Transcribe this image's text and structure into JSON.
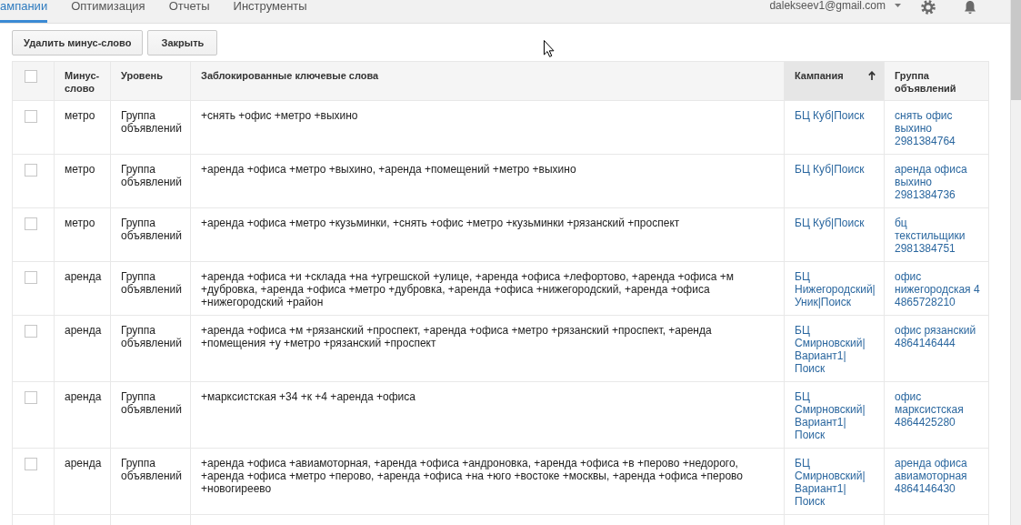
{
  "nav": {
    "tabs": [
      {
        "label": "ампании",
        "selected": true
      },
      {
        "label": "Оптимизация",
        "selected": false
      },
      {
        "label": "Отчеты",
        "selected": false
      },
      {
        "label": "Инструменты",
        "selected": false
      }
    ],
    "account": "dalekseev1@gmail.com"
  },
  "toolbar": {
    "buttons": [
      "Удалить минус-слово",
      "Закрыть"
    ]
  },
  "table": {
    "select_all_checked": false,
    "columns": [
      {
        "label": "Минус-слово",
        "sorted": false
      },
      {
        "label": "Уровень",
        "sorted": false
      },
      {
        "label": "Заблокированные ключевые слова",
        "sorted": false
      },
      {
        "label": "Кампания",
        "sorted": true
      },
      {
        "label": "Группа объявлений",
        "sorted": false
      }
    ],
    "rows": [
      {
        "checked": false,
        "negative_keyword": "метро",
        "scope": "Группа объявлений",
        "blocked_keywords": "+снять +офис +метро +выхино",
        "campaign": "БЦ Куб|Поиск",
        "ad_group": "снять офис выхино 2981384764"
      },
      {
        "checked": false,
        "negative_keyword": "метро",
        "scope": "Группа объявлений",
        "blocked_keywords": "+аренда +офиса +метро +выхино, +аренда +помещений +метро +выхино",
        "campaign": "БЦ Куб|Поиск",
        "ad_group": "аренда офиса выхино 2981384736"
      },
      {
        "checked": false,
        "negative_keyword": "метро",
        "scope": "Группа объявлений",
        "blocked_keywords": "+аренда +офиса +метро +кузьминки, +снять +офис +метро +кузьминки +рязанский +проспект",
        "campaign": "БЦ Куб|Поиск",
        "ad_group": "бц текстильщики 2981384751"
      },
      {
        "checked": false,
        "negative_keyword": "аренда",
        "scope": "Группа объявлений",
        "blocked_keywords": "+аренда +офиса +и +склада +на +угрешской +улице, +аренда +офиса +лефортово, +аренда +офиса +м +дубровка, +аренда +офиса +метро +дубровка, +аренда +офиса +нижегородский, +аренда +офиса +нижегородский +район",
        "campaign": "БЦ Нижегородский|Уник|Поиск",
        "ad_group": "офис нижегородская 4 4865728210"
      },
      {
        "checked": false,
        "negative_keyword": "аренда",
        "scope": "Группа объявлений",
        "blocked_keywords": "+аренда +офиса +м +рязанский +проспект, +аренда +офиса +метро +рязанский +проспект, +аренда +помещения +у +метро +рязанский +проспект",
        "campaign": "БЦ Смирновский|Вариант1|Поиск",
        "ad_group": "офис рязанский 4864146444"
      },
      {
        "checked": false,
        "negative_keyword": "аренда",
        "scope": "Группа объявлений",
        "blocked_keywords": "+марксистская +34 +к +4 +аренда +офиса",
        "campaign": "БЦ Смирновский|Вариант1|Поиск",
        "ad_group": "офис марксистская 4864425280"
      },
      {
        "checked": false,
        "negative_keyword": "аренда",
        "scope": "Группа объявлений",
        "blocked_keywords": "+аренда +офиса +авиамоторная, +аренда +офиса +андроновка, +аренда +офиса +в +перово +недорого, +аренда +офиса +метро +перово, +аренда +офиса +на +юго +востоке +москвы, +аренда +офиса +перово +новогиреево",
        "campaign": "БЦ Смирновский|Вариант1|Поиск",
        "ad_group": "аренда офиса авиамоторная 4864146430"
      }
    ]
  }
}
